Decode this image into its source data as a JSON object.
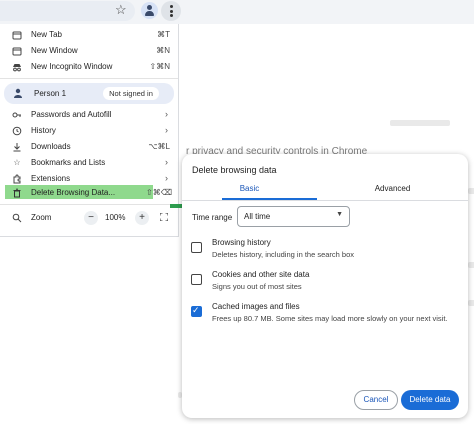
{
  "menu": {
    "items_top": [
      {
        "icon": "new-tab-icon",
        "label": "New Tab",
        "shortcut": "⌘T"
      },
      {
        "icon": "new-window-icon",
        "label": "New Window",
        "shortcut": "⌘N"
      },
      {
        "icon": "incognito-icon",
        "label": "New Incognito Window",
        "shortcut": "⇧⌘N"
      }
    ],
    "person": {
      "label": "Person 1",
      "badge": "Not signed in"
    },
    "items_bottom": [
      {
        "icon": "key-icon",
        "label": "Passwords and Autofill",
        "shortcut": "",
        "arrow": "›"
      },
      {
        "icon": "history-icon",
        "label": "History",
        "shortcut": "",
        "arrow": "›"
      },
      {
        "icon": "download-icon",
        "label": "Downloads",
        "shortcut": "⌥⌘L",
        "arrow": ""
      },
      {
        "icon": "star-icon",
        "label": "Bookmarks and Lists",
        "shortcut": "",
        "arrow": "›"
      },
      {
        "icon": "extensions-icon",
        "label": "Extensions",
        "shortcut": "",
        "arrow": "›"
      },
      {
        "icon": "trash-icon",
        "label": "Delete Browsing Data...",
        "shortcut": "⇧⌘⌫",
        "arrow": ""
      }
    ],
    "zoom": {
      "label": "Zoom",
      "minus": "−",
      "value": "100%",
      "plus": "+"
    }
  },
  "background": {
    "snippet": "r privacy and security controls in Chrome"
  },
  "dialog": {
    "title": "Delete browsing data",
    "tabs": [
      "Basic",
      "Advanced"
    ],
    "time_range_label": "Time range",
    "time_range_value": "All time",
    "options": [
      {
        "title": "Browsing history",
        "desc": "Deletes history, including in the search box",
        "checked": false
      },
      {
        "title": "Cookies and other site data",
        "desc": "Signs you out of most sites",
        "checked": false
      },
      {
        "title": "Cached images and files",
        "desc": "Frees up 80.7 MB. Some sites may load more slowly on your next visit.",
        "checked": true
      }
    ],
    "cancel_label": "Cancel",
    "delete_label": "Delete data"
  },
  "colors": {
    "accent": "#1a6cd6",
    "highlight": "#8fd98d",
    "arrow": "#2e9e4f"
  }
}
